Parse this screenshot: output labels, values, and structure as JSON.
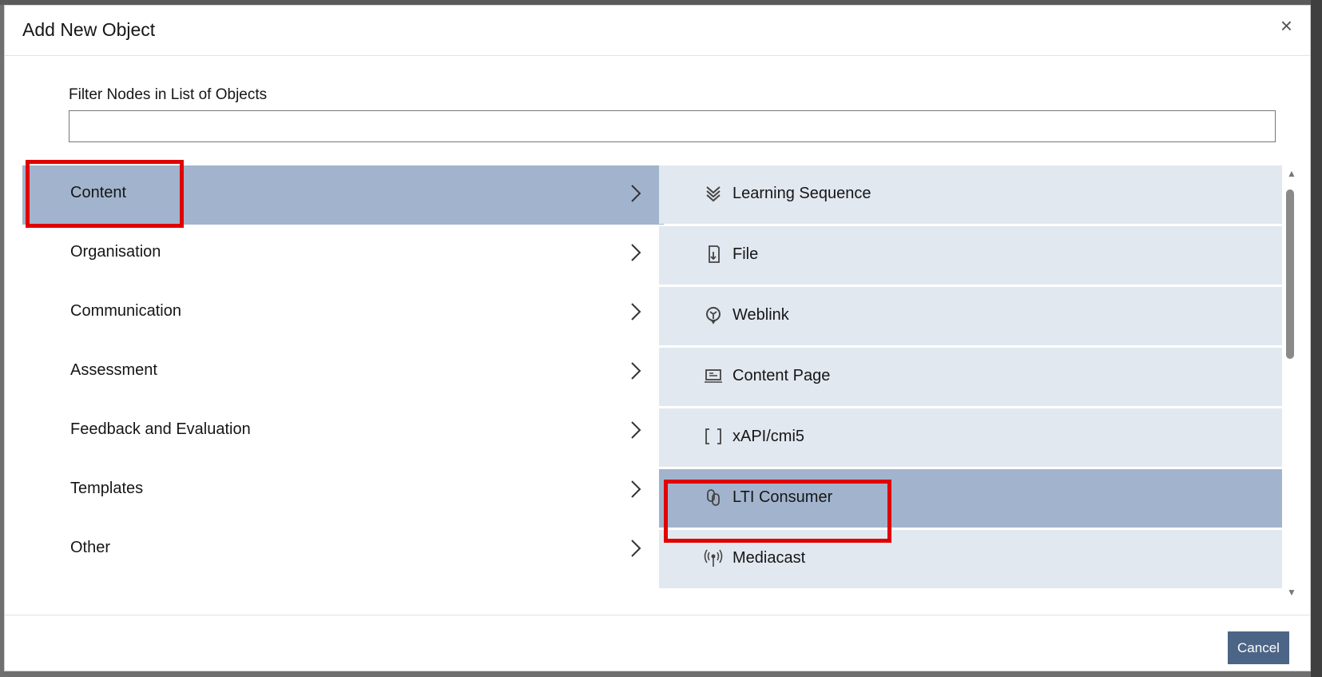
{
  "modal": {
    "title": "Add New Object",
    "close_label": "×",
    "cancel_label": "Cancel"
  },
  "filter": {
    "label": "Filter Nodes in List of Objects",
    "value": "",
    "placeholder": ""
  },
  "categories": [
    {
      "label": "Content",
      "active": true
    },
    {
      "label": "Organisation",
      "active": false
    },
    {
      "label": "Communication",
      "active": false
    },
    {
      "label": "Assessment",
      "active": false
    },
    {
      "label": "Feedback and Evaluation",
      "active": false
    },
    {
      "label": "Templates",
      "active": false
    },
    {
      "label": "Other",
      "active": false
    }
  ],
  "objects": [
    {
      "label": "Learning Sequence",
      "icon": "learning-sequence-icon",
      "active": false
    },
    {
      "label": "File",
      "icon": "file-icon",
      "active": false
    },
    {
      "label": "Weblink",
      "icon": "weblink-icon",
      "active": false
    },
    {
      "label": "Content Page",
      "icon": "content-page-icon",
      "active": false
    },
    {
      "label": "xAPI/cmi5",
      "icon": "xapi-icon",
      "active": false
    },
    {
      "label": "LTI Consumer",
      "icon": "lti-icon",
      "active": true
    },
    {
      "label": "Mediacast",
      "icon": "mediacast-icon",
      "active": false
    }
  ],
  "colors": {
    "active_bg": "#a2b4cd",
    "item_bg": "#e2e8f0",
    "highlight": "#e00000",
    "button_bg": "#4c6586"
  }
}
